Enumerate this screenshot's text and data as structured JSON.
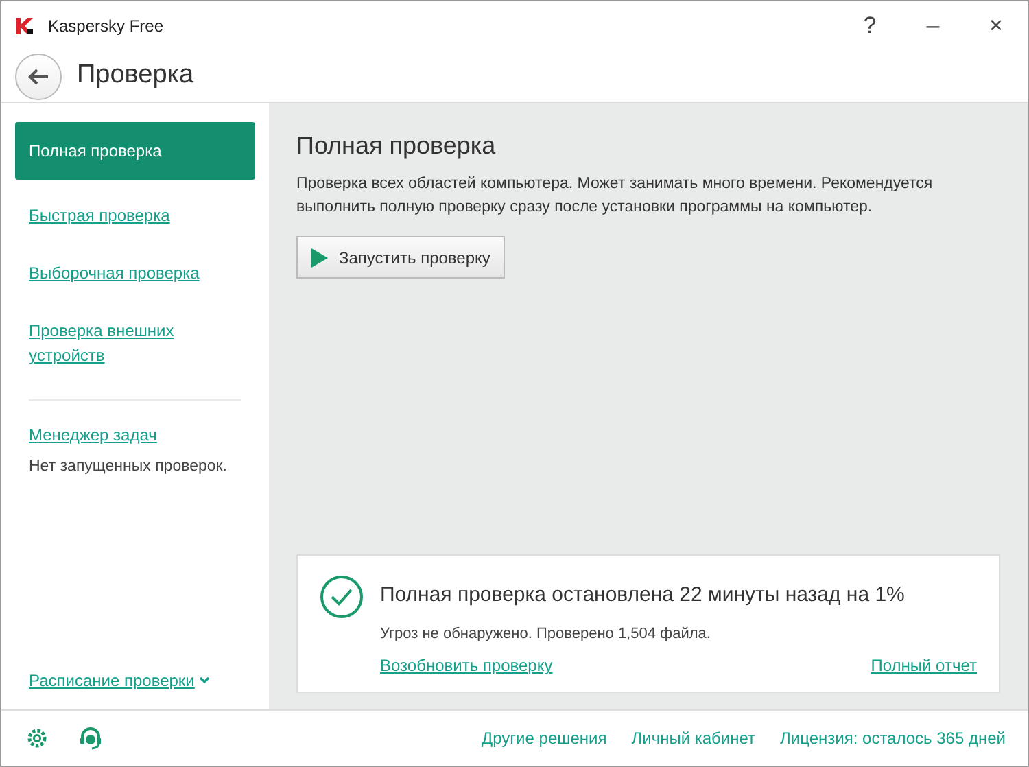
{
  "window": {
    "title": "Kaspersky Free",
    "controls": [
      "?",
      "–",
      "×"
    ]
  },
  "header": {
    "title": "Проверка"
  },
  "sidebar": {
    "items": [
      {
        "label": "Полная проверка",
        "selected": true
      },
      {
        "label": "Быстрая проверка",
        "selected": false
      },
      {
        "label": "Выборочная проверка",
        "selected": false
      },
      {
        "label": "Проверка внешних устройств",
        "selected": false
      }
    ],
    "task_manager": {
      "link": "Менеджер задач",
      "status": "Нет запущенных проверок."
    },
    "schedule": "Расписание проверки"
  },
  "main": {
    "title": "Полная проверка",
    "description": "Проверка всех областей компьютера. Может занимать много времени. Рекомендуется выполнить полную проверку сразу после установки программы на компьютер.",
    "button": "Запустить проверку"
  },
  "status_card": {
    "title": "Полная проверка остановлена 22 минуты назад на 1%",
    "details": "Угроз не обнаружено. Проверено 1,504 файла.",
    "resume": "Возобновить проверку",
    "report": "Полный отчет"
  },
  "footer": {
    "links": [
      "Другие решения",
      "Личный кабинет",
      "Лицензия: осталось 365 дней"
    ]
  }
}
